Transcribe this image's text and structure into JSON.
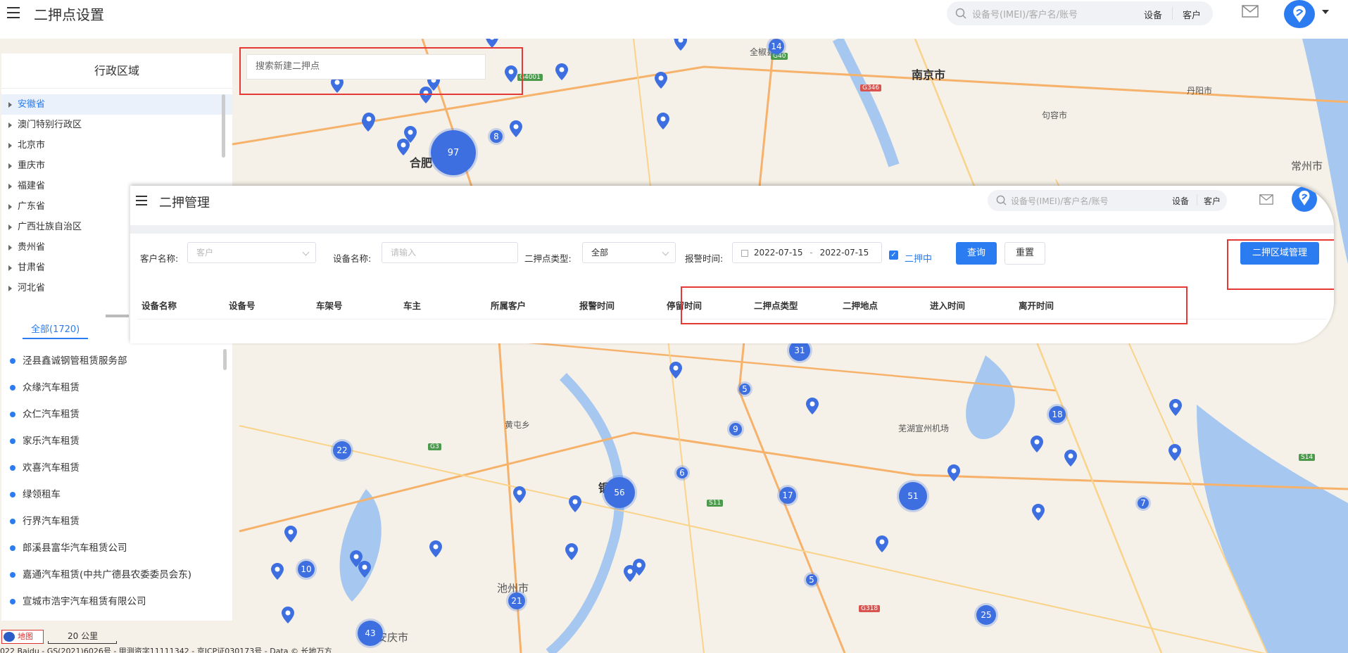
{
  "topbar": {
    "title": "二押点设置",
    "search_placeholder": "设备号(IMEI)/客户名/账号",
    "search_device": "设备",
    "search_customer": "客户"
  },
  "left_panel": {
    "title": "行政区域",
    "provinces": [
      "安徽省",
      "澳门特别行政区",
      "北京市",
      "重庆市",
      "福建省",
      "广东省",
      "广西壮族自治区",
      "贵州省",
      "甘肃省",
      "河北省"
    ],
    "active_province": "安徽省",
    "tab_all": "全部(1720)",
    "customers": [
      "泾县鑫诚钢管租赁服务部",
      "众缘汽车租赁",
      "众仁汽车租赁",
      "家乐汽车租赁",
      "欢喜汽车租赁",
      "绿领租车",
      "行界汽车租赁",
      "郎溪县富华汽车租赁公司",
      "嘉通汽车租赁(中共广德县农委委员会东)",
      "宣城市浩宇汽车租赁有限公司"
    ]
  },
  "map": {
    "search_new_placeholder": "搜索新建二押点",
    "places": {
      "nanjing": "南京市",
      "hefei": "合肥",
      "changzhou": "常州市",
      "chizhou": "池州市",
      "anqing": "安庆市",
      "danyang": "丹阳市",
      "jurong": "句容市",
      "quanjiao": "全椒县",
      "huangtun": "黄屯乡",
      "tongling": "铜",
      "wuhu": "芜湖宣州机场"
    },
    "clusters": [
      "97",
      "14",
      "8",
      "9",
      "56",
      "6",
      "31",
      "5",
      "9",
      "22",
      "17",
      "51",
      "18",
      "7",
      "10",
      "21",
      "43",
      "25",
      "5"
    ]
  },
  "overlay": {
    "title": "二押管理",
    "search_placeholder": "设备号(IMEI)/客户名/账号",
    "search_device": "设备",
    "search_customer": "客户",
    "filters": {
      "customer_label": "客户名称:",
      "customer_placeholder": "客户",
      "device_label": "设备名称:",
      "device_placeholder": "请输入",
      "type_label": "二押点类型:",
      "type_value": "全部",
      "alarm_label": "报警时间:",
      "date_start": "2022-07-15",
      "date_sep": "-",
      "date_end": "2022-07-15",
      "check_label": "二押中",
      "query_button": "查询",
      "reset_button": "重置",
      "manage_button": "二押区域管理"
    },
    "columns": [
      "设备名称",
      "设备号",
      "车架号",
      "车主",
      "所属客户",
      "报警时间",
      "停留时间",
      "二押点类型",
      "二押地点",
      "进入时间",
      "离开时间"
    ]
  },
  "attribution": {
    "logo_text": "地图",
    "scale": "20 公里",
    "copyright": "022 Baidu - GS(2021)6026号 - 甲测资字11111342 - 京ICP证030173号 - Data © 长地万方"
  }
}
